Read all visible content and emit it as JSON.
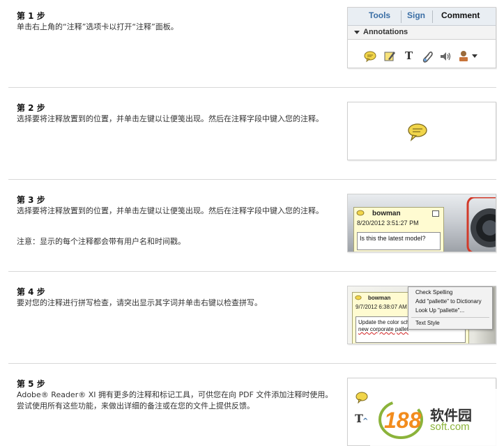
{
  "steps": [
    {
      "title": "第 1 步",
      "text": "单击右上角的“注释”选项卡以打开“注释”面板。",
      "thumb": {
        "tabs": [
          "Tools",
          "Sign",
          "Comment"
        ],
        "panel_label": "Annotations",
        "tool_icons": [
          "sticky-note-icon",
          "highlight-icon",
          "text-icon",
          "attach-icon",
          "audio-icon",
          "stamp-icon"
        ]
      }
    },
    {
      "title": "第 2 步",
      "text": "选择要将注释放置到的位置，并单击左键以让便笺出现。然后在注释字段中键入您的注释。",
      "thumb": {
        "icon": "sticky-note-icon"
      }
    },
    {
      "title": "第 3 步",
      "text": "选择要将注释放置到的位置，并单击左键以让便笺出现。然后在注释字段中键入您的注释。",
      "note": "注意：显示的每个注释都会带有用户名和时间戳。",
      "thumb": {
        "user": "bowman",
        "date": "8/20/2012 3:51:27 PM",
        "comment": "Is this the latest model?"
      }
    },
    {
      "title": "第 4 步",
      "text": "要对您的注释进行拼写检查，请突出显示其字词并单击右键以检查拼写。",
      "thumb": {
        "user": "bowman",
        "date": "9/7/2012 6:38:07 AM",
        "comment_line1": "Update the color sch",
        "comment_line2": "new corporate pallet",
        "menu": [
          "Check Spelling",
          "Add \"pallette\" to Dictionary",
          "Look Up \"pallette\"...",
          "Text Style"
        ]
      }
    },
    {
      "title": "第 5 步",
      "text": "Adobe® Reader® XI 拥有更多的注释和标记工具，可供您在向 PDF 文件添加注释时使用。尝试使用所有这些功能，来做出详细的备注或在您的文件上提供反馈。",
      "thumb": {
        "icons": [
          "sticky-note-icon",
          "text-edit-icon"
        ]
      }
    }
  ],
  "watermark": {
    "number": "188",
    "name": "软件园",
    "url": "soft.com"
  },
  "colors": {
    "accent_tab": "#3a6ea5",
    "note_yellow": "#fffbd1",
    "icon_yellow": "#f1d54a",
    "watermark_orange": "#f28c1d",
    "watermark_green": "#8bb33a"
  }
}
